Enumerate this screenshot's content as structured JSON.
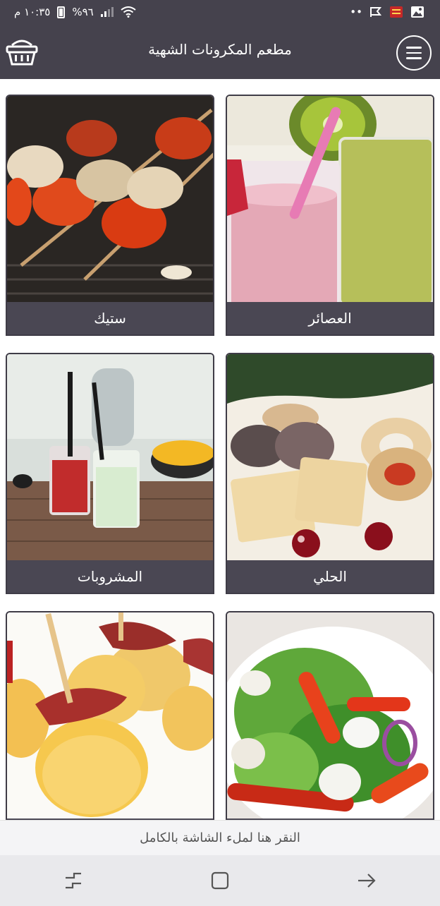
{
  "status_bar": {
    "time": "١٠:٣٥ م",
    "battery": "%٩٦",
    "icons": [
      "gallery-icon",
      "app-badge-icon",
      "checkmark-flag-icon",
      "more-dots-icon",
      "battery-icon",
      "signal-icon",
      "wifi-icon"
    ]
  },
  "app_bar": {
    "title": "مطعم المكرونات الشهية",
    "left_icon": "basket-icon",
    "right_icon": "menu-icon"
  },
  "categories": [
    {
      "label": "العصائر",
      "image": "juice-smoothies-photo"
    },
    {
      "label": "ستيك",
      "image": "grilled-kebab-skewers-photo"
    },
    {
      "label": "الحلي",
      "image": "cookies-pastries-photo"
    },
    {
      "label": "المشروبات",
      "image": "cocktail-drinks-photo"
    },
    {
      "label": "",
      "image": "mixed-salad-photo"
    },
    {
      "label": "",
      "image": "bacon-croquettes-photo"
    }
  ],
  "banner": {
    "text": "النقر هنا لملء الشاشة بالكامل"
  },
  "nav_bar": {
    "buttons": [
      "recent-apps-icon",
      "home-icon",
      "back-icon"
    ]
  },
  "colors": {
    "header": "#45424d",
    "card_label_bg": "#4a4753",
    "banner_bg": "#f4f4f6",
    "navbar_bg": "#e9e9ec"
  }
}
